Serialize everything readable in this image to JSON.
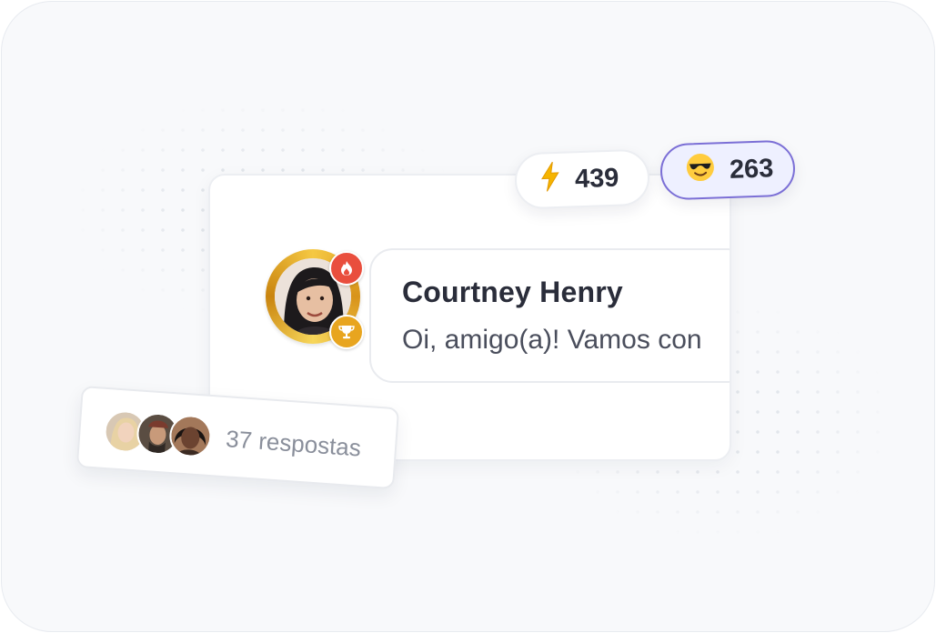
{
  "stats": {
    "energy": {
      "icon": "lightning-icon",
      "value": "439"
    },
    "cool": {
      "icon": "sunglasses-emoji-icon",
      "value": "263"
    }
  },
  "message": {
    "author": "Courtney Henry",
    "text": "Oi, amigo(a)! Vamos con",
    "badges": [
      "fire-badge-icon",
      "trophy-badge-icon"
    ]
  },
  "replies": {
    "label": "37 respostas"
  },
  "colors": {
    "accent": "#7b6fd6",
    "gold": "#f5c843",
    "fire": "#e94e3d"
  }
}
